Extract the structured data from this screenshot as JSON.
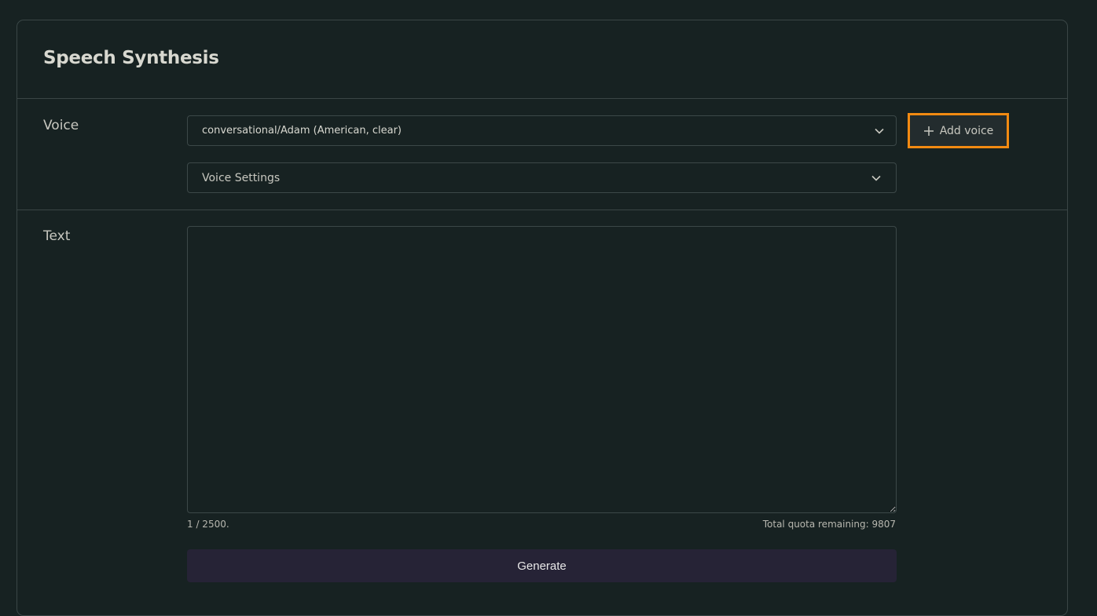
{
  "page": {
    "title": "Speech Synthesis"
  },
  "voice": {
    "label": "Voice",
    "selected": "conversational/Adam (American, clear)",
    "settings_label": "Voice Settings",
    "add_button_label": "Add voice"
  },
  "text": {
    "label": "Text",
    "value": "",
    "char_count": "1 / 2500.",
    "quota": "Total quota remaining: 9807"
  },
  "actions": {
    "generate_label": "Generate"
  },
  "colors": {
    "background": "#172222",
    "border": "#3a4646",
    "highlight": "#f28a12",
    "generate_bg": "#262336"
  },
  "icons": {
    "add": "plus-icon",
    "dropdown": "chevron-down-icon",
    "resize": "resize-grip-icon"
  }
}
